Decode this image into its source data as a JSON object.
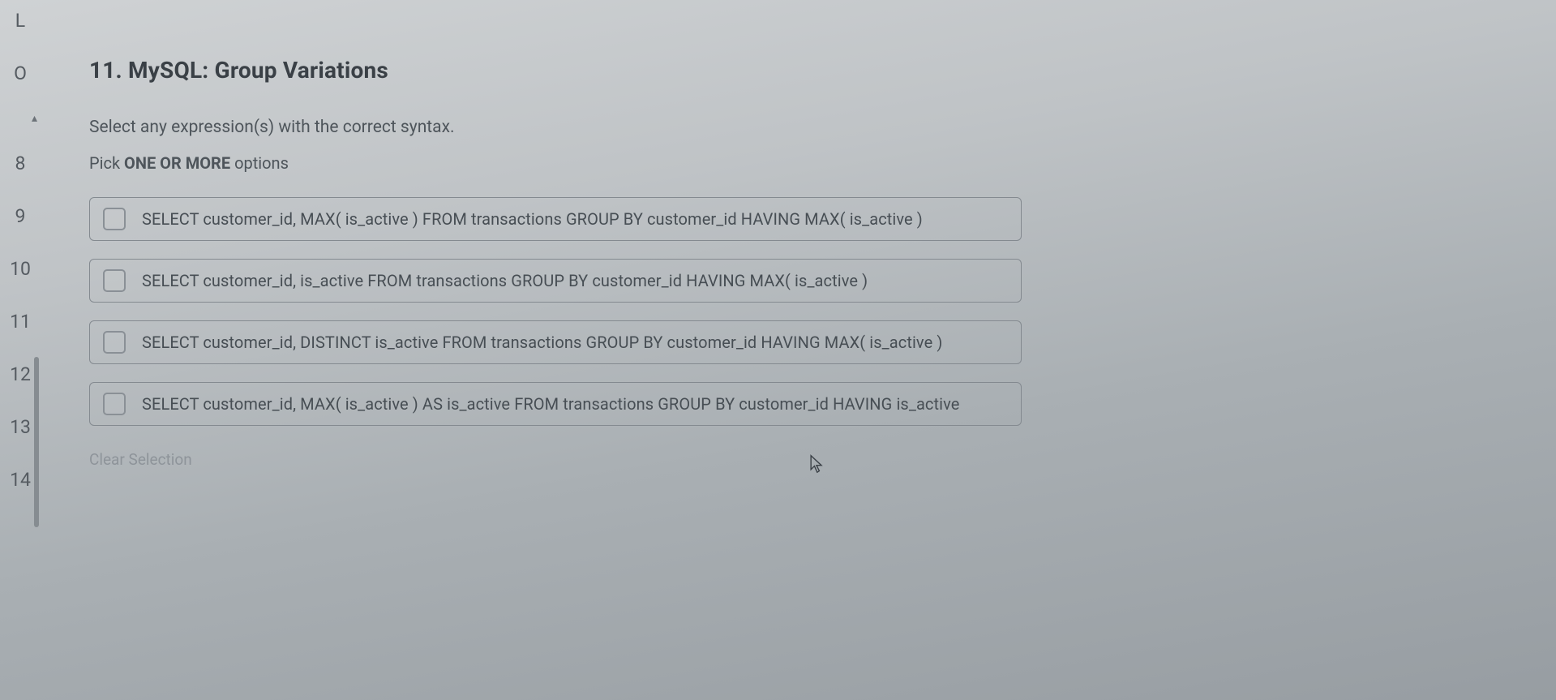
{
  "sidebar": {
    "items": [
      "L",
      "O",
      "8",
      "9",
      "10",
      "11",
      "12",
      "13",
      "14"
    ],
    "caret": "▴"
  },
  "question": {
    "title": "11. MySQL: Group Variations",
    "prompt": "Select any expression(s) with the correct syntax.",
    "pick_prefix": "Pick ",
    "pick_emph": "ONE OR MORE",
    "pick_suffix": " options",
    "options": [
      "SELECT customer_id, MAX( is_active ) FROM transactions GROUP BY customer_id HAVING MAX( is_active )",
      "SELECT customer_id, is_active FROM transactions GROUP BY customer_id HAVING MAX( is_active )",
      "SELECT customer_id, DISTINCT is_active FROM transactions GROUP BY customer_id HAVING MAX( is_active )",
      "SELECT customer_id, MAX( is_active ) AS is_active FROM transactions GROUP BY customer_id HAVING is_active"
    ],
    "clear": "Clear Selection"
  }
}
